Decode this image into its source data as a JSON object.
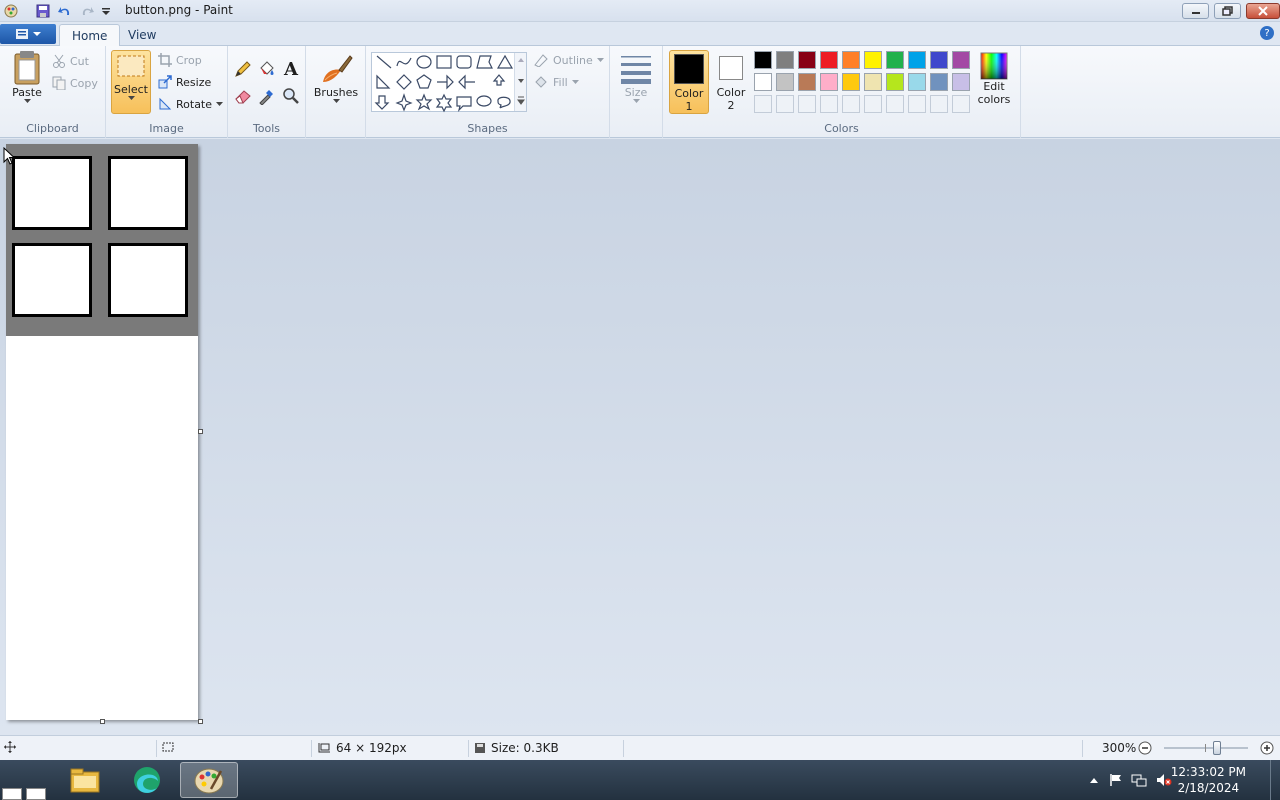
{
  "window": {
    "title": "button.png - Paint"
  },
  "tabs": [
    {
      "label": "Home"
    },
    {
      "label": "View"
    }
  ],
  "clipboard": {
    "paste": "Paste",
    "cut": "Cut",
    "copy": "Copy",
    "label": "Clipboard"
  },
  "image": {
    "select": "Select",
    "crop": "Crop",
    "resize": "Resize",
    "rotate": "Rotate",
    "label": "Image"
  },
  "tools": {
    "label": "Tools",
    "text_glyph": "A"
  },
  "brushes": {
    "label": "Brushes"
  },
  "shapes": {
    "outline": "Outline",
    "fill": "Fill",
    "label": "Shapes"
  },
  "size": {
    "label": "Size"
  },
  "colors": {
    "color1_line1": "Color",
    "color1_line2": "1",
    "color2_line1": "Color",
    "color2_line2": "2",
    "edit_line1": "Edit",
    "edit_line2": "colors",
    "label": "Colors",
    "color1_value": "#000000",
    "color2_value": "#ffffff",
    "palette_row1": [
      "#000000",
      "#7f7f7f",
      "#880015",
      "#ed1c24",
      "#ff7f27",
      "#fff200",
      "#22b14c",
      "#00a2e8",
      "#3f48cc",
      "#a349a4"
    ],
    "palette_row2": [
      "#ffffff",
      "#c3c3c3",
      "#b97a57",
      "#ffaec9",
      "#ffc90e",
      "#efe4b0",
      "#b5e61d",
      "#99d9ea",
      "#7092be",
      "#c8bfe7"
    ]
  },
  "status": {
    "dimensions": "64 × 192px",
    "size": "Size: 0.3KB",
    "zoom": "300%",
    "zoom_level": 0.75
  },
  "taskbar": {
    "time": "12:33:02 PM",
    "date": "2/18/2024"
  }
}
